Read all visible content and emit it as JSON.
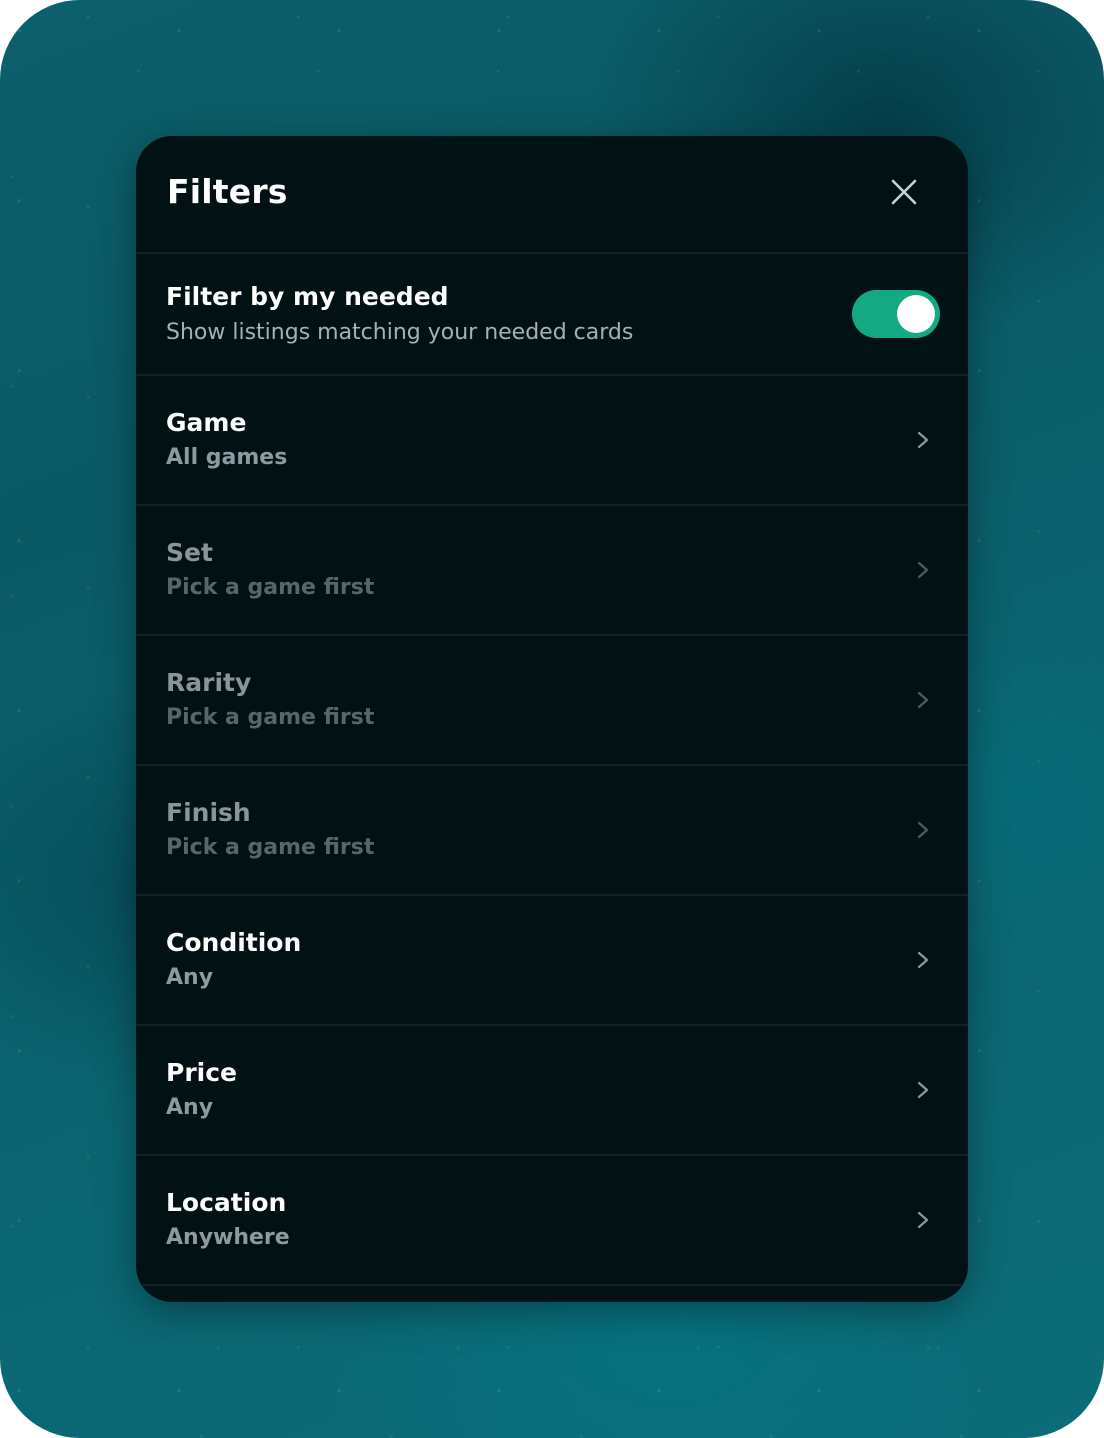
{
  "panel": {
    "title": "Filters"
  },
  "toggle_row": {
    "title": "Filter by my needed",
    "subtitle": "Show listings matching your needed cards",
    "enabled": true
  },
  "filters": [
    {
      "title": "Game",
      "value": "All games",
      "disabled": false
    },
    {
      "title": "Set",
      "value": "Pick a game first",
      "disabled": true
    },
    {
      "title": "Rarity",
      "value": "Pick a game first",
      "disabled": true
    },
    {
      "title": "Finish",
      "value": "Pick a game first",
      "disabled": true
    },
    {
      "title": "Condition",
      "value": "Any",
      "disabled": false
    },
    {
      "title": "Price",
      "value": "Any",
      "disabled": false
    },
    {
      "title": "Location",
      "value": "Anywhere",
      "disabled": false
    }
  ],
  "icons": {
    "close": "close-icon",
    "chevron": "chevron-right-icon"
  },
  "colors": {
    "panel_bg": "#021214",
    "accent": "#13a982",
    "divider": "#0d2528"
  }
}
